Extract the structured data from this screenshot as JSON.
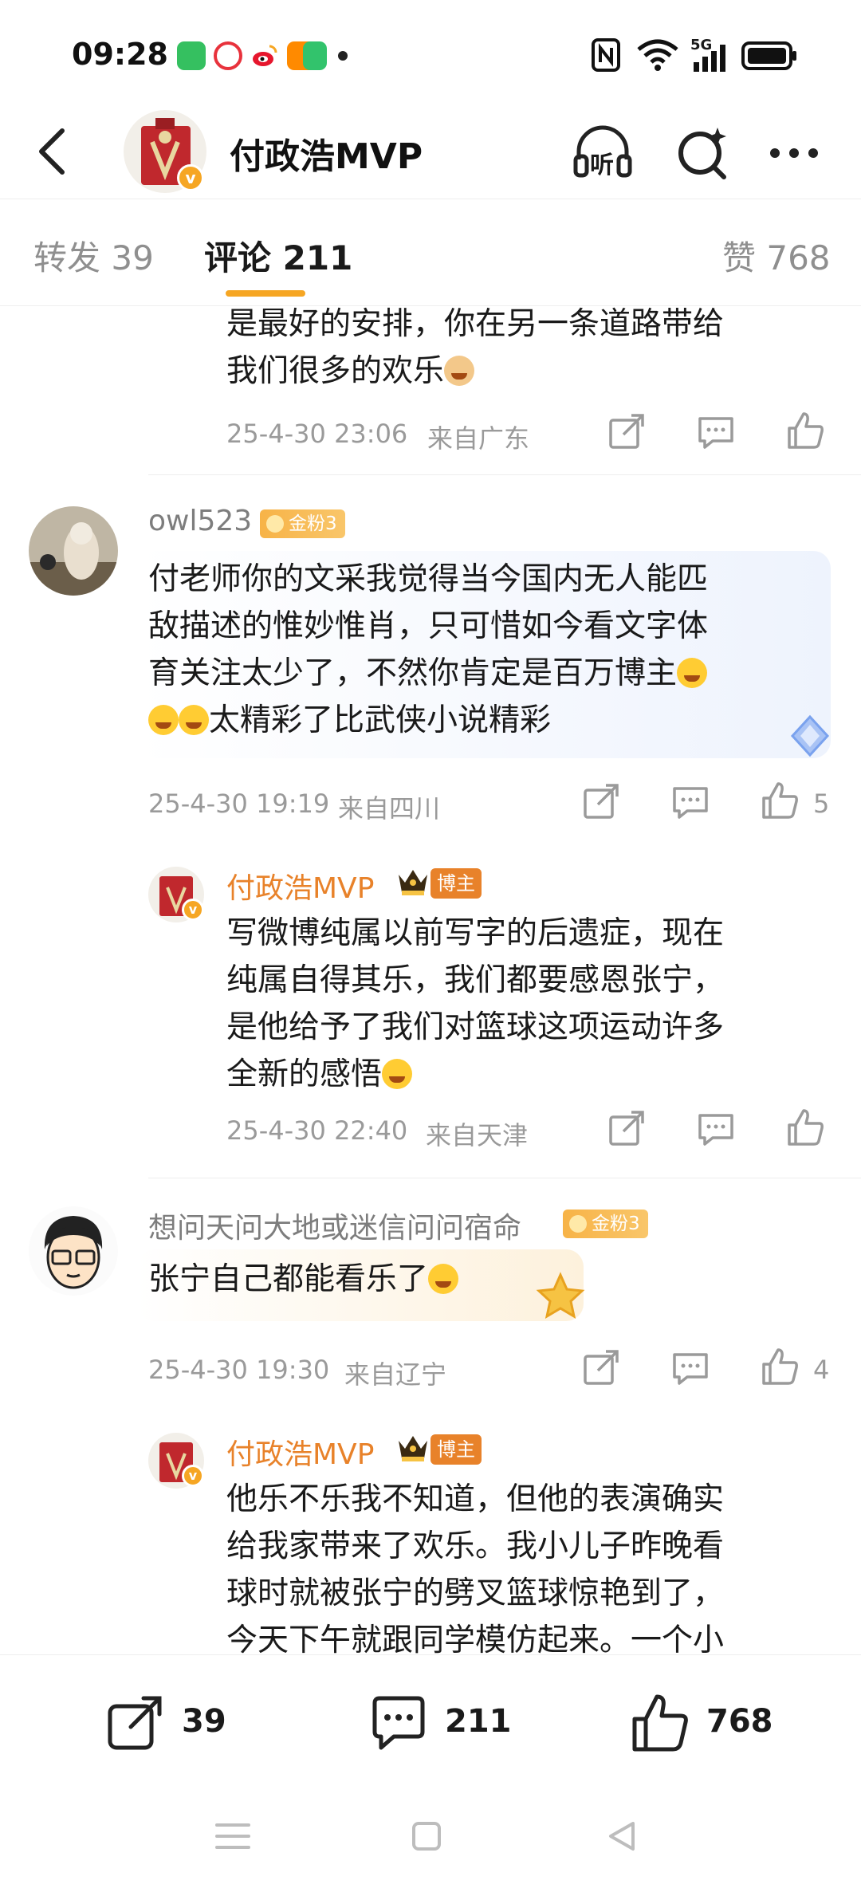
{
  "status_bar": {
    "time": "09:28",
    "network": "5G"
  },
  "header": {
    "title": "付政浩MVP",
    "listen_label": "听",
    "verified_mark": "v"
  },
  "tabs": [
    {
      "label": "转发 39"
    },
    {
      "label": "评论 211"
    },
    {
      "label": "赞 768"
    }
  ],
  "comments": [
    {
      "text_lines": [
        "是最好的安排，你在另一条道路带给",
        "我们很多的欢乐"
      ],
      "time": "25-4-30 23:06",
      "location": "来自广东"
    },
    {
      "username": "owl523",
      "fan_badge": "金粉3",
      "text_lines": [
        "付老师你的文采我觉得当今国内无人能匹",
        "敌描述的惟妙惟肖，只可惜如今看文字体",
        "育关注太少了，不然你肯定是百万博主",
        "太精彩了比武侠小说精彩"
      ],
      "time": "25-4-30 19:19",
      "location": "来自四川",
      "likes": "5"
    },
    {
      "username": "付政浩MVP",
      "boss_badge": "博主",
      "text_lines": [
        "写微博纯属以前写字的后遗症，现在",
        "纯属自得其乐，我们都要感恩张宁，",
        "是他给予了我们对篮球这项运动许多",
        "全新的感悟"
      ],
      "time": "25-4-30 22:40",
      "location": "来自天津"
    },
    {
      "username": "想问天问大地或迷信问问宿命",
      "fan_badge": "金粉3",
      "text_lines": [
        "张宁自己都能看乐了"
      ],
      "time": "25-4-30 19:30",
      "location": "来自辽宁",
      "likes": "4"
    },
    {
      "username": "付政浩MVP",
      "boss_badge": "博主",
      "text_lines": [
        "他乐不乐我不知道，但他的表演确实",
        "给我家带来了欢乐。我小儿子昨晚看",
        "球时就被张宁的劈叉篮球惊艳到了，",
        "今天下午就跟同学模仿起来。一个小"
      ]
    }
  ],
  "bottom_bar": {
    "reposts": "39",
    "comments": "211",
    "likes": "768"
  },
  "colors": {
    "accent": "#f6a623",
    "author_name": "#e8822a",
    "meta": "#9a9a9a"
  }
}
